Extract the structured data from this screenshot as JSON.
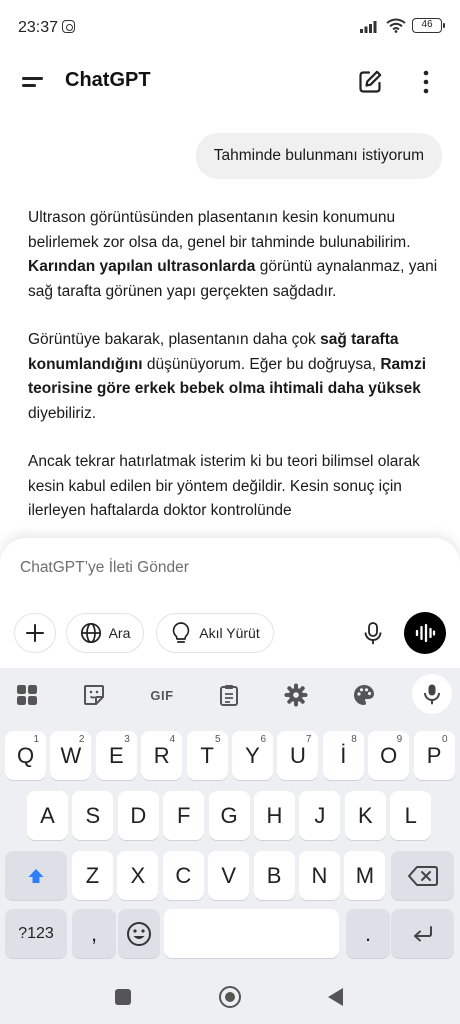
{
  "status_bar": {
    "time": "23:37",
    "battery": "46"
  },
  "header": {
    "title": "ChatGPT"
  },
  "chat": {
    "user_message": "Tahminde bulunmanı istiyorum",
    "assistant": {
      "p1_a": "Ultrason görüntüsünden plasentanın kesin konumunu belirlemek zor olsa da, genel bir tahminde bulunabilirim. ",
      "p1_b": "Karından yapılan ultrasonlarda",
      "p1_c": " görüntü aynalanmaz, yani sağ tarafta görünen yapı gerçekten sağdadır.",
      "p2_a": "Görüntüye bakarak, plasentanın daha çok ",
      "p2_b": "sağ tarafta konumlandığını",
      "p2_c": " düşünüyorum. Eğer bu doğruysa, ",
      "p2_d": "Ramzi teorisine göre erkek bebek olma ihtimali daha yüksek",
      "p2_e": " diyebiliriz.",
      "p3": "Ancak tekrar hatırlatmak isterim ki bu teori bilimsel olarak kesin kabul edilen bir yöntem değildir. Kesin sonuç için ilerleyen haftalarda doktor kontrolünde"
    }
  },
  "composer": {
    "placeholder": "ChatGPT’ye İleti Gönder",
    "search_label": "Ara",
    "think_label": "Akıl Yürüt"
  },
  "keyboard": {
    "toolbar": {
      "gif_label": "GIF"
    },
    "row1": [
      {
        "k": "Q",
        "h": "1"
      },
      {
        "k": "W",
        "h": "2"
      },
      {
        "k": "E",
        "h": "3"
      },
      {
        "k": "R",
        "h": "4"
      },
      {
        "k": "T",
        "h": "5"
      },
      {
        "k": "Y",
        "h": "6"
      },
      {
        "k": "U",
        "h": "7"
      },
      {
        "k": "İ",
        "h": "8"
      },
      {
        "k": "O",
        "h": "9"
      },
      {
        "k": "P",
        "h": "0"
      }
    ],
    "row2": [
      "A",
      "S",
      "D",
      "F",
      "G",
      "H",
      "J",
      "K",
      "L"
    ],
    "row3": [
      "Z",
      "X",
      "C",
      "V",
      "B",
      "N",
      "M"
    ],
    "symbols_label": "?123",
    "comma_label": ",",
    "period_label": ".",
    "colors": {
      "shift_arrow": "#2d7ff9",
      "voice_button": "#000000"
    }
  }
}
